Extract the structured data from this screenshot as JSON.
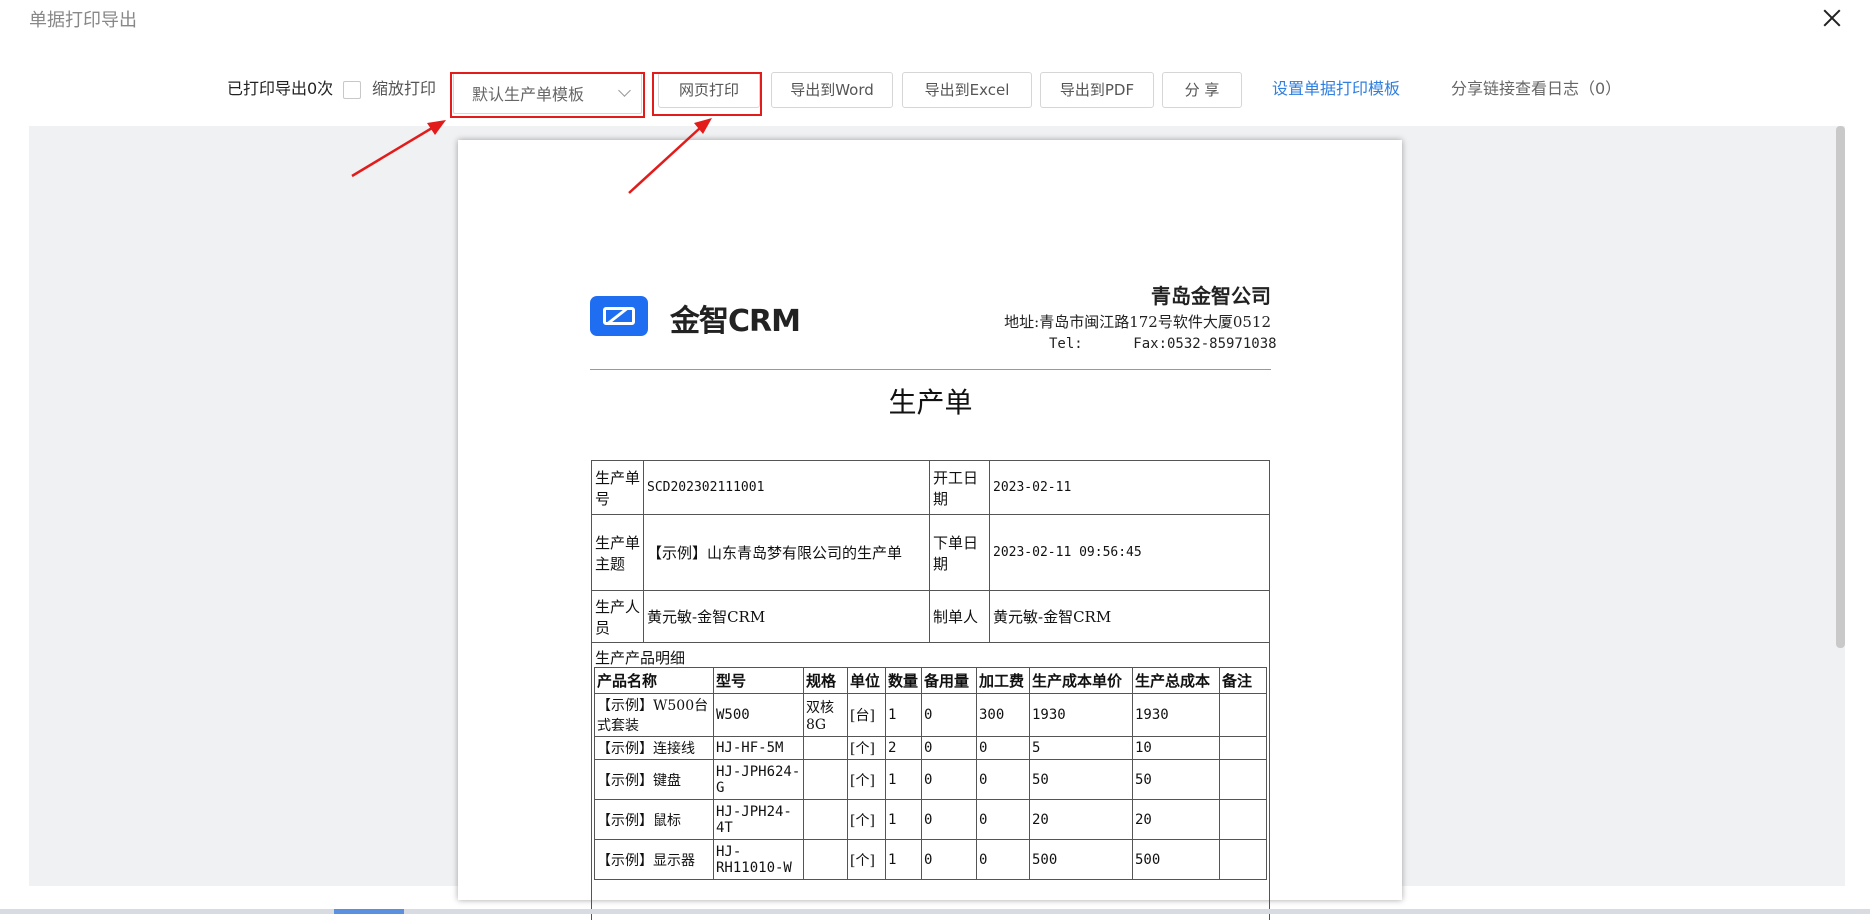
{
  "window": {
    "title": "单据打印导出"
  },
  "toolbar": {
    "printed_count": "已打印导出0次",
    "scale_print_label": "缩放打印",
    "template_select": "默认生产单模板",
    "web_print": "网页打印",
    "export_word": "导出到Word",
    "export_excel": "导出到Excel",
    "export_pdf": "导出到PDF",
    "share": "分 享",
    "set_template": "设置单据打印模板",
    "share_log": "分享链接查看日志（0）"
  },
  "colors": {
    "accent": "#2f7fe0",
    "highlight": "#e21b1b",
    "logo": "#1f6ef2"
  },
  "document": {
    "logo_text": "金智CRM",
    "company_name": "青岛金智公司",
    "address": "地址:青岛市闽江路172号软件大厦0512",
    "tel_line": "Tel:      Fax:0532-85971038",
    "title": "生产单",
    "fields": {
      "order_no_label": "生产单号",
      "order_no": "SCD202302111001",
      "start_date_label": "开工日期",
      "start_date": "2023-02-11",
      "subject_label": "生产单主题",
      "subject": "【示例】山东青岛梦有限公司的生产单",
      "order_date_label": "下单日期",
      "order_date": "2023-02-11 09:56:45",
      "staff_label": "生产人员",
      "staff": "黄元敏-金智CRM",
      "creator_label": "制单人",
      "creator": "黄元敏-金智CRM"
    },
    "detail_title": "生产产品明细",
    "detail_headers": [
      "产品名称",
      "型号",
      "规格",
      "单位",
      "数量",
      "备用量",
      "加工费",
      "生产成本单价",
      "生产总成本",
      "备注"
    ],
    "detail_rows": [
      [
        "【示例】W500台式套装",
        "W500",
        "双核8G",
        "[台]",
        "1",
        "0",
        "300",
        "1930",
        "1930",
        ""
      ],
      [
        "【示例】连接线",
        "HJ-HF-5M",
        "",
        "[个]",
        "2",
        "0",
        "0",
        "5",
        "10",
        ""
      ],
      [
        "【示例】键盘",
        "HJ-JPH624-G",
        "",
        "[个]",
        "1",
        "0",
        "0",
        "50",
        "50",
        ""
      ],
      [
        "【示例】鼠标",
        "HJ-JPH24-4T",
        "",
        "[个]",
        "1",
        "0",
        "0",
        "20",
        "20",
        ""
      ],
      [
        "【示例】显示器",
        "HJ-RH11010-W",
        "",
        "[个]",
        "1",
        "0",
        "0",
        "500",
        "500",
        ""
      ]
    ]
  }
}
